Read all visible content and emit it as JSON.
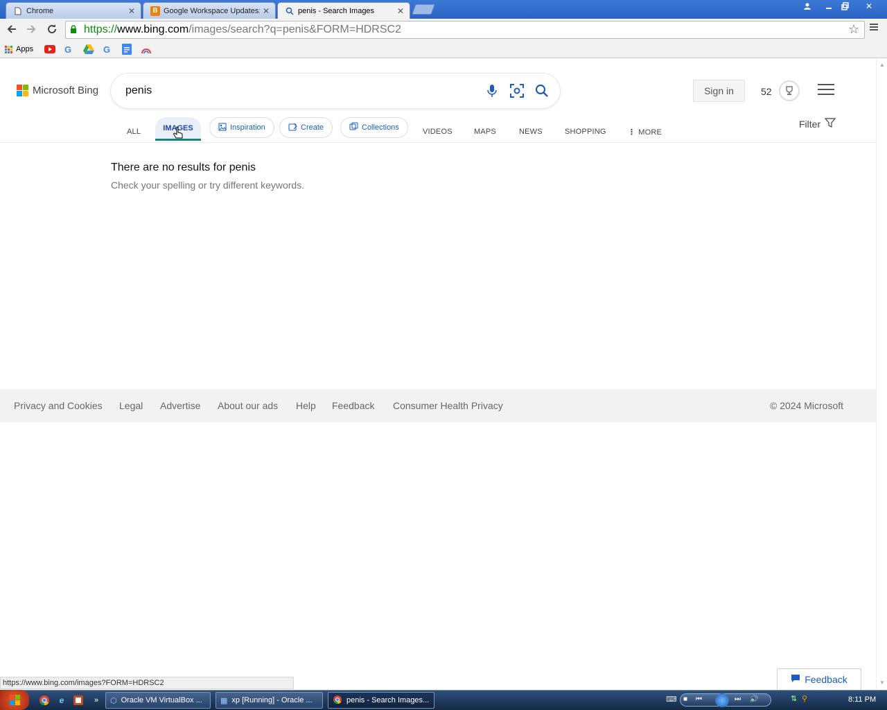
{
  "browser": {
    "tabs": [
      {
        "title": "Chrome",
        "icon": "page-icon"
      },
      {
        "title": "Google Workspace Updates:",
        "icon": "blogger-icon"
      },
      {
        "title": "penis - Search Images",
        "icon": "search-icon"
      }
    ],
    "url": {
      "scheme": "https://",
      "host": "www.bing.com",
      "path": "/images/search?q=penis&FORM=HDRSC2"
    },
    "bookmarks": {
      "apps_label": "Apps"
    }
  },
  "bing": {
    "logo_text": "Microsoft Bing",
    "query": "penis",
    "sign_in": "Sign in",
    "points": "52",
    "tabs": {
      "all": "ALL",
      "images": "IMAGES",
      "inspiration": "Inspiration",
      "create": "Create",
      "collections": "Collections",
      "videos": "VIDEOS",
      "maps": "MAPS",
      "news": "NEWS",
      "shopping": "SHOPPING",
      "more": "MORE"
    },
    "filter": "Filter",
    "no_results_title": "There are no results for penis",
    "no_results_sub": "Check your spelling or try different keywords.",
    "footer": {
      "privacy": "Privacy and Cookies",
      "legal": "Legal",
      "advertise": "Advertise",
      "about_ads": "About our ads",
      "help": "Help",
      "feedback": "Feedback",
      "health": "Consumer Health Privacy",
      "copyright": "© 2024 Microsoft"
    },
    "feedback_button": "Feedback"
  },
  "status_url": "https://www.bing.com/images?FORM=HDRSC2",
  "taskbar": {
    "buttons": [
      "Oracle VM VirtualBox ...",
      "xp [Running] - Oracle ...",
      "penis - Search Images..."
    ],
    "clock": "8:11 PM"
  },
  "colors": {
    "bing_blue": "#1a5bc4",
    "active_underline": "#17827f",
    "ms_red": "#f25022",
    "ms_green": "#7fba00",
    "ms_blue": "#00a4ef",
    "ms_yellow": "#ffb900"
  }
}
